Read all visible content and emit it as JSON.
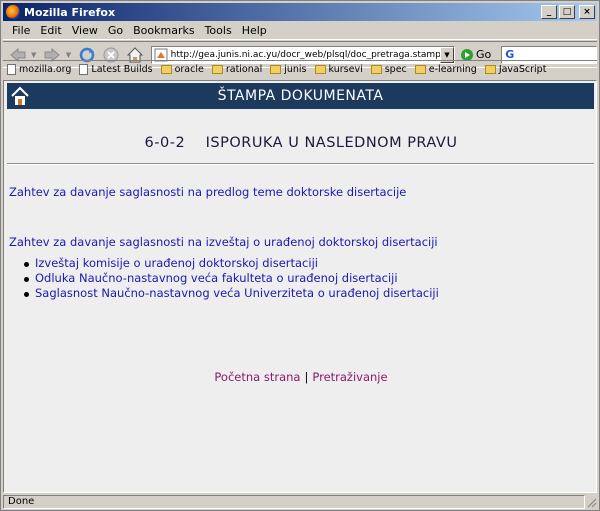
{
  "window": {
    "title": "Mozilla Firefox"
  },
  "menu": [
    "File",
    "Edit",
    "View",
    "Go",
    "Bookmarks",
    "Tools",
    "Help"
  ],
  "navigation": {
    "url": "http://gea.junis.ni.ac.yu/docr_web/plsql/doc_pretraga.stampa_meni?p_fak",
    "go_label": "Go",
    "search_engine_glyph": "G"
  },
  "bookmarks": [
    {
      "label": "mozilla.org",
      "type": "page"
    },
    {
      "label": "Latest Builds",
      "type": "page"
    },
    {
      "label": "oracle",
      "type": "folder"
    },
    {
      "label": "rational",
      "type": "folder"
    },
    {
      "label": "junis",
      "type": "folder"
    },
    {
      "label": "kursevi",
      "type": "folder"
    },
    {
      "label": "spec",
      "type": "folder"
    },
    {
      "label": "e-learning",
      "type": "folder"
    },
    {
      "label": "JavaScript",
      "type": "folder"
    }
  ],
  "page": {
    "header_title": "ŠTAMPA DOKUMENATA",
    "doc_title": "6-0-2    ISPORUKA U NASLEDNOM PRAVU",
    "link_teme": "Zahtev za davanje saglasnosti na predlog teme doktorske disertacije",
    "link_izvestaj": "Zahtev za davanje saglasnosti na izveštaj o urađenoj doktorskoj disertaciji",
    "sub_links": [
      "Izveštaj komisije o urađenoj doktorskoj disertaciji",
      "Odluka Naučno-nastavnog veća fakulteta o urađenoj disertaciji",
      "Saglasnost Naučno-nastavnog veća Univerziteta o urađenoj disertaciji"
    ],
    "footer": {
      "home": "Početna strana",
      "separator": "|",
      "search": "Pretraživanje"
    }
  },
  "status": {
    "text": "Done"
  },
  "colors": {
    "header_bg": "#1c3a5e",
    "link": "#1a1ab0",
    "footer_link": "#8b1a6b",
    "content_bg": "#eeeeee"
  }
}
